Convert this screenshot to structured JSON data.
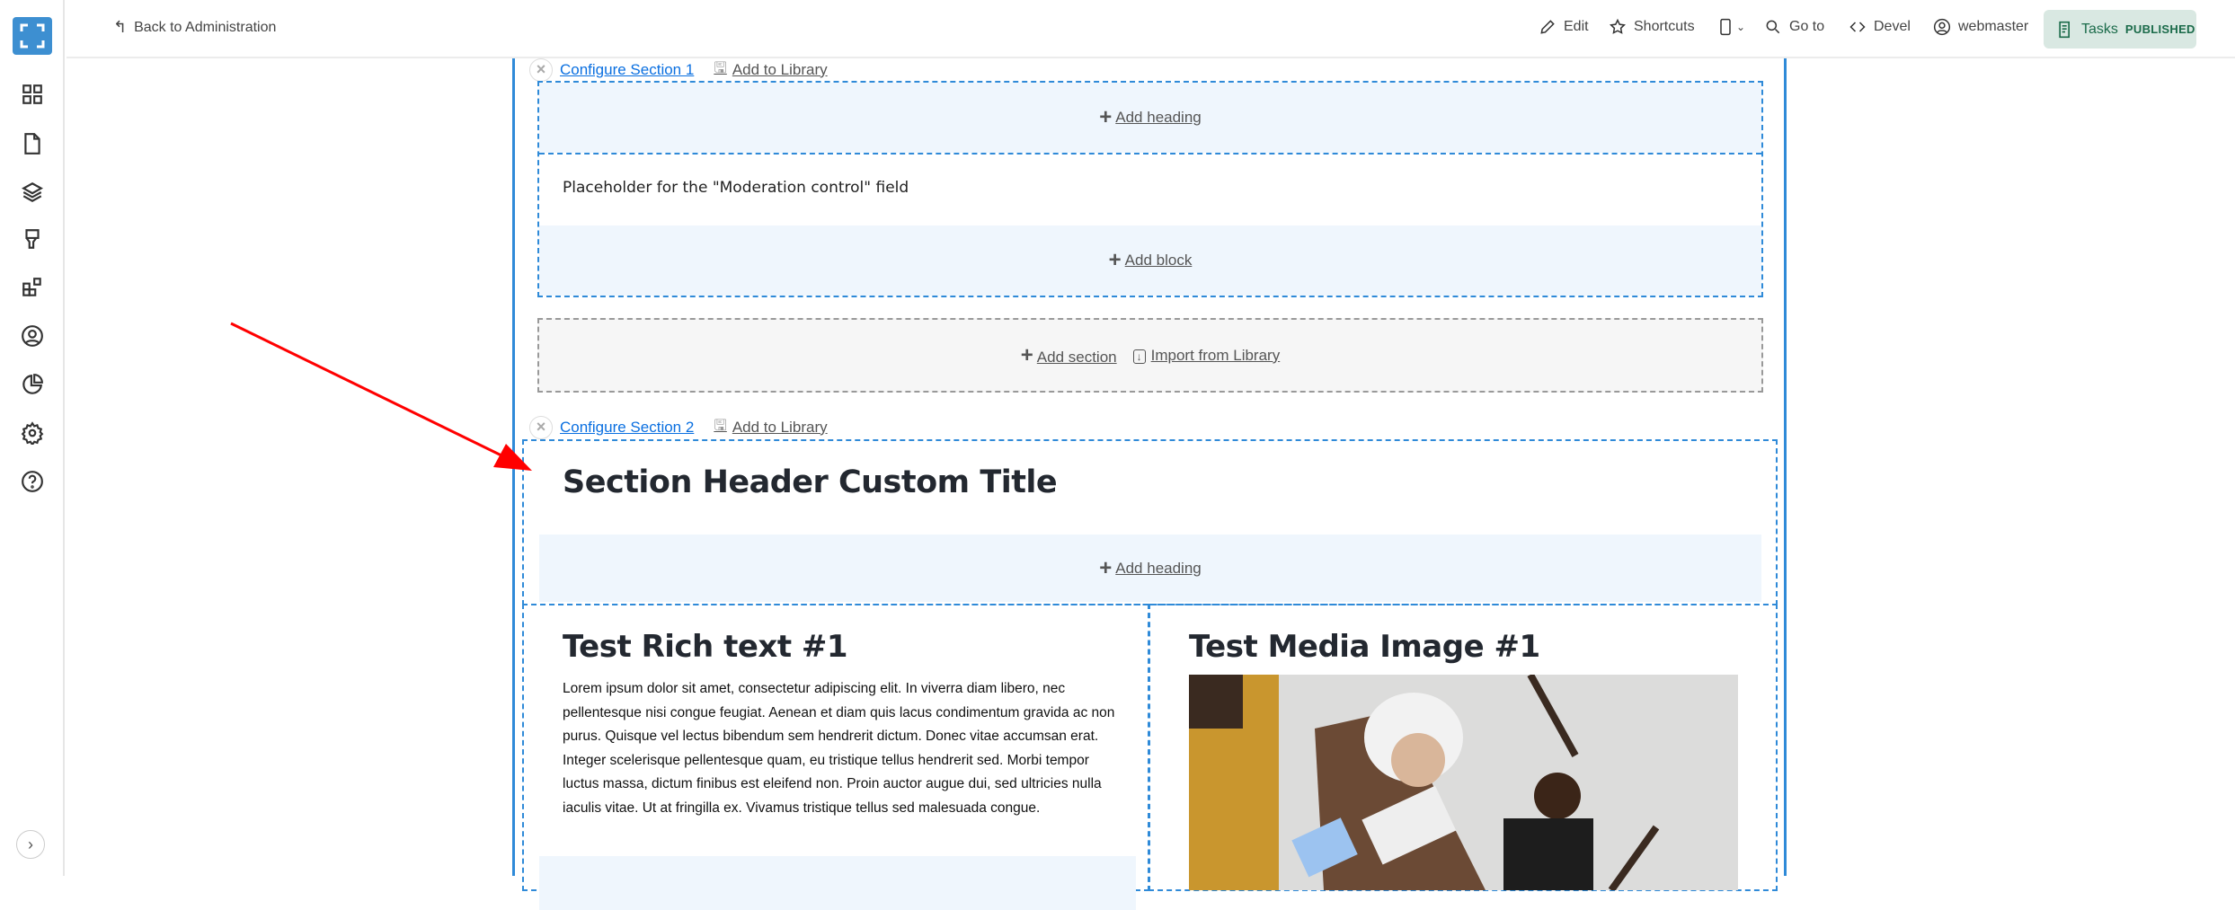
{
  "header": {
    "back_label": "Back to Administration",
    "toolbar": [
      {
        "label": "Edit",
        "icon": "pencil-icon"
      },
      {
        "label": "Shortcuts",
        "icon": "star-icon"
      },
      {
        "label": "",
        "icon": "device-icon"
      },
      {
        "label": "Go to",
        "icon": "search-icon"
      },
      {
        "label": "Devel",
        "icon": "code-icon"
      },
      {
        "label": "webmaster",
        "icon": "user-icon"
      }
    ],
    "tasks_label": "Tasks",
    "status_badge": "PUBLISHED"
  },
  "sidebar": {
    "items": [
      "dashboard",
      "content",
      "structure",
      "appearance",
      "extend",
      "people",
      "reports",
      "configuration",
      "help"
    ]
  },
  "section1": {
    "configure": "Configure Section 1",
    "add_to_library": "Add to Library",
    "add_heading": "Add heading",
    "placeholder_text": "Placeholder for the \"Moderation control\" field",
    "add_block": "Add block"
  },
  "add_section": {
    "add": "Add section",
    "import": "Import from Library"
  },
  "section2": {
    "configure": "Configure Section 2",
    "add_to_library": "Add to Library",
    "title": "Section Header Custom Title",
    "add_heading": "Add heading",
    "rich_title": "Test Rich text #1",
    "rich_body": "Lorem ipsum dolor sit amet, consectetur adipiscing elit. In viverra diam libero, nec pellentesque nisi congue feugiat. Aenean et diam quis lacus condimentum gravida ac non purus. Quisque vel lectus bibendum sem hendrerit dictum. Donec vitae accumsan erat. Integer scelerisque pellentesque quam, eu tristique tellus hendrerit sed. Morbi tempor luctus massa, dictum finibus est eleifend non. Proin auctor augue dui, sed ultricies nulla iaculis vitae. Ut at fringilla ex. Vivamus tristique tellus sed malesuada congue.",
    "media_title": "Test Media Image #1"
  },
  "colors": {
    "accent": "#2f8ad8",
    "link": "#0a6fe0",
    "band": "#eff6fd",
    "published": "#1b6b4a",
    "arrow": "#ff0000"
  }
}
